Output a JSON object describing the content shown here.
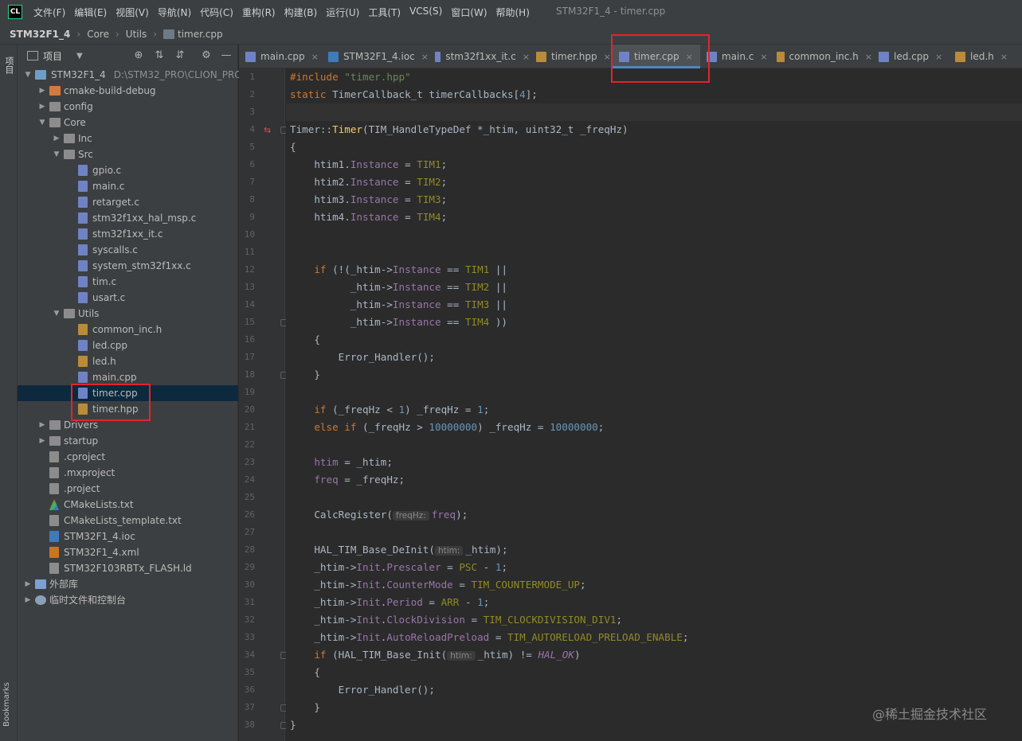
{
  "window": {
    "title": "STM32F1_4 - timer.cpp",
    "logo": "CL"
  },
  "menu": [
    "文件(F)",
    "编辑(E)",
    "视图(V)",
    "导航(N)",
    "代码(C)",
    "重构(R)",
    "构建(B)",
    "运行(U)",
    "工具(T)",
    "VCS(S)",
    "窗口(W)",
    "帮助(H)"
  ],
  "breadcrumb": {
    "project": "STM32F1_4",
    "items": [
      "Core",
      "Utils",
      "timer.cpp"
    ]
  },
  "stripe": {
    "project_label": "项目",
    "bookmarks_label": "Bookmarks"
  },
  "project_panel": {
    "title": "项目",
    "root_label": "STM32F1_4",
    "root_path": "D:\\STM32_PRO\\CLION_PRO",
    "tree": [
      {
        "label": "cmake-build-debug",
        "icon": "folder-orange",
        "arrow": "right",
        "indent": 1
      },
      {
        "label": "config",
        "icon": "folder",
        "arrow": "right",
        "indent": 1
      },
      {
        "label": "Core",
        "icon": "folder",
        "arrow": "down",
        "indent": 1
      },
      {
        "label": "Inc",
        "icon": "folder",
        "arrow": "right",
        "indent": 2
      },
      {
        "label": "Src",
        "icon": "folder",
        "arrow": "down",
        "indent": 2
      },
      {
        "label": "gpio.c",
        "icon": "file-c",
        "indent": 3
      },
      {
        "label": "main.c",
        "icon": "file-c",
        "indent": 3
      },
      {
        "label": "retarget.c",
        "icon": "file-c",
        "indent": 3
      },
      {
        "label": "stm32f1xx_hal_msp.c",
        "icon": "file-c",
        "indent": 3
      },
      {
        "label": "stm32f1xx_it.c",
        "icon": "file-c",
        "indent": 3
      },
      {
        "label": "syscalls.c",
        "icon": "file-c",
        "indent": 3
      },
      {
        "label": "system_stm32f1xx.c",
        "icon": "file-c",
        "indent": 3
      },
      {
        "label": "tim.c",
        "icon": "file-c",
        "indent": 3
      },
      {
        "label": "usart.c",
        "icon": "file-c",
        "indent": 3
      },
      {
        "label": "Utils",
        "icon": "folder",
        "arrow": "down",
        "indent": 2
      },
      {
        "label": "common_inc.h",
        "icon": "file-h",
        "indent": 3
      },
      {
        "label": "led.cpp",
        "icon": "file-cpp",
        "indent": 3
      },
      {
        "label": "led.h",
        "icon": "file-h",
        "indent": 3
      },
      {
        "label": "main.cpp",
        "icon": "file-cpp",
        "indent": 3
      },
      {
        "label": "timer.cpp",
        "icon": "file-cpp",
        "indent": 3,
        "selected": true
      },
      {
        "label": "timer.hpp",
        "icon": "file-h",
        "indent": 3
      },
      {
        "label": "Drivers",
        "icon": "folder",
        "arrow": "right",
        "indent": 1
      },
      {
        "label": "startup",
        "icon": "folder",
        "arrow": "right",
        "indent": 1
      },
      {
        "label": ".cproject",
        "icon": "file-txt",
        "indent": 1
      },
      {
        "label": ".mxproject",
        "icon": "file-txt",
        "indent": 1
      },
      {
        "label": ".project",
        "icon": "file-txt",
        "indent": 1
      },
      {
        "label": "CMakeLists.txt",
        "icon": "cmake",
        "indent": 1
      },
      {
        "label": "CMakeLists_template.txt",
        "icon": "file-txt",
        "indent": 1
      },
      {
        "label": "STM32F1_4.ioc",
        "icon": "file-ioc",
        "indent": 1
      },
      {
        "label": "STM32F1_4.xml",
        "icon": "file-xml",
        "indent": 1
      },
      {
        "label": "STM32F103RBTx_FLASH.ld",
        "icon": "file-txt",
        "indent": 1
      },
      {
        "label": "外部库",
        "icon": "lib",
        "arrow": "right",
        "indent": 0
      },
      {
        "label": "临时文件和控制台",
        "icon": "scratch",
        "arrow": "right",
        "indent": 0
      }
    ]
  },
  "tabs": [
    {
      "label": "main.cpp",
      "icon": "file-cpp"
    },
    {
      "label": "STM32F1_4.ioc",
      "icon": "file-ioc"
    },
    {
      "label": "stm32f1xx_it.c",
      "icon": "file-c"
    },
    {
      "label": "timer.hpp",
      "icon": "file-h"
    },
    {
      "label": "timer.cpp",
      "icon": "file-cpp",
      "active": true
    },
    {
      "label": "main.c",
      "icon": "file-c"
    },
    {
      "label": "common_inc.h",
      "icon": "file-h"
    },
    {
      "label": "led.cpp",
      "icon": "file-cpp"
    },
    {
      "label": "led.h",
      "icon": "file-h"
    }
  ],
  "code": {
    "current_line": 3,
    "lines": [
      [
        [
          "kw",
          "#include "
        ],
        [
          "str",
          "\"timer.hpp\""
        ]
      ],
      [
        [
          "kw",
          "static "
        ],
        [
          "",
          "TimerCallback_t timerCallbacks["
        ],
        [
          "num",
          "4"
        ],
        [
          "",
          "];"
        ]
      ],
      [],
      [
        [
          "",
          "Timer::"
        ],
        [
          "fn",
          "Timer"
        ],
        [
          "",
          "(TIM_HandleTypeDef *_htim, uint32_t _freqHz)"
        ]
      ],
      [
        [
          "",
          "{"
        ]
      ],
      [
        [
          "",
          "    htim1."
        ],
        [
          "fld",
          "Instance"
        ],
        [
          "",
          " = "
        ],
        [
          "mac",
          "TIM1"
        ],
        [
          "",
          ";"
        ]
      ],
      [
        [
          "",
          "    htim2."
        ],
        [
          "fld",
          "Instance"
        ],
        [
          "",
          " = "
        ],
        [
          "mac",
          "TIM2"
        ],
        [
          "",
          ";"
        ]
      ],
      [
        [
          "",
          "    htim3."
        ],
        [
          "fld",
          "Instance"
        ],
        [
          "",
          " = "
        ],
        [
          "mac",
          "TIM3"
        ],
        [
          "",
          ";"
        ]
      ],
      [
        [
          "",
          "    htim4."
        ],
        [
          "fld",
          "Instance"
        ],
        [
          "",
          " = "
        ],
        [
          "mac",
          "TIM4"
        ],
        [
          "",
          ";"
        ]
      ],
      [],
      [],
      [
        [
          "",
          "    "
        ],
        [
          "kw",
          "if "
        ],
        [
          "",
          "(!(_htim->"
        ],
        [
          "fld",
          "Instance"
        ],
        [
          "",
          " == "
        ],
        [
          "mac",
          "TIM1"
        ],
        [
          "",
          " ||"
        ]
      ],
      [
        [
          "",
          "          _htim->"
        ],
        [
          "fld",
          "Instance"
        ],
        [
          "",
          " == "
        ],
        [
          "mac",
          "TIM2"
        ],
        [
          "",
          " ||"
        ]
      ],
      [
        [
          "",
          "          _htim->"
        ],
        [
          "fld",
          "Instance"
        ],
        [
          "",
          " == "
        ],
        [
          "mac",
          "TIM3"
        ],
        [
          "",
          " ||"
        ]
      ],
      [
        [
          "",
          "          _htim->"
        ],
        [
          "fld",
          "Instance"
        ],
        [
          "",
          " == "
        ],
        [
          "mac",
          "TIM4"
        ],
        [
          "",
          " ))"
        ]
      ],
      [
        [
          "",
          "    {"
        ]
      ],
      [
        [
          "",
          "        Error_Handler();"
        ]
      ],
      [
        [
          "",
          "    }"
        ]
      ],
      [],
      [
        [
          "",
          "    "
        ],
        [
          "kw",
          "if "
        ],
        [
          "",
          "(_freqHz < "
        ],
        [
          "num",
          "1"
        ],
        [
          "",
          ") _freqHz = "
        ],
        [
          "num",
          "1"
        ],
        [
          "",
          ";"
        ]
      ],
      [
        [
          "",
          "    "
        ],
        [
          "kw",
          "else if "
        ],
        [
          "",
          "(_freqHz > "
        ],
        [
          "num",
          "10000000"
        ],
        [
          "",
          ") _freqHz = "
        ],
        [
          "num",
          "10000000"
        ],
        [
          "",
          ";"
        ]
      ],
      [],
      [
        [
          "",
          "    "
        ],
        [
          "fld",
          "htim"
        ],
        [
          "",
          " = _htim;"
        ]
      ],
      [
        [
          "",
          "    "
        ],
        [
          "fld",
          "freq"
        ],
        [
          "",
          " = _freqHz;"
        ]
      ],
      [],
      [
        [
          "",
          "    CalcRegister("
        ],
        [
          "hint",
          "freqHz:"
        ],
        [
          "fld",
          "freq"
        ],
        [
          "",
          ");"
        ]
      ],
      [],
      [
        [
          "",
          "    HAL_TIM_Base_DeInit("
        ],
        [
          "hint",
          "htim:"
        ],
        [
          "",
          "_htim);"
        ]
      ],
      [
        [
          "",
          "    _htim->"
        ],
        [
          "fld",
          "Init"
        ],
        [
          "",
          "."
        ],
        [
          "fld",
          "Prescaler"
        ],
        [
          "",
          " = "
        ],
        [
          "mac",
          "PSC"
        ],
        [
          "",
          " - "
        ],
        [
          "num",
          "1"
        ],
        [
          "",
          ";"
        ]
      ],
      [
        [
          "",
          "    _htim->"
        ],
        [
          "fld",
          "Init"
        ],
        [
          "",
          "."
        ],
        [
          "fld",
          "CounterMode"
        ],
        [
          "",
          " = "
        ],
        [
          "mac",
          "TIM_COUNTERMODE_UP"
        ],
        [
          "",
          ";"
        ]
      ],
      [
        [
          "",
          "    _htim->"
        ],
        [
          "fld",
          "Init"
        ],
        [
          "",
          "."
        ],
        [
          "fld",
          "Period"
        ],
        [
          "",
          " = "
        ],
        [
          "mac",
          "ARR"
        ],
        [
          "",
          " - "
        ],
        [
          "num",
          "1"
        ],
        [
          "",
          ";"
        ]
      ],
      [
        [
          "",
          "    _htim->"
        ],
        [
          "fld",
          "Init"
        ],
        [
          "",
          "."
        ],
        [
          "fld",
          "ClockDivision"
        ],
        [
          "",
          " = "
        ],
        [
          "mac",
          "TIM_CLOCKDIVISION_DIV1"
        ],
        [
          "",
          ";"
        ]
      ],
      [
        [
          "",
          "    _htim->"
        ],
        [
          "fld",
          "Init"
        ],
        [
          "",
          "."
        ],
        [
          "fld",
          "AutoReloadPreload"
        ],
        [
          "",
          " = "
        ],
        [
          "mac",
          "TIM_AUTORELOAD_PRELOAD_ENABLE"
        ],
        [
          "",
          ";"
        ]
      ],
      [
        [
          "",
          "    "
        ],
        [
          "kw",
          "if "
        ],
        [
          "",
          "(HAL_TIM_Base_Init("
        ],
        [
          "hint",
          "htim:"
        ],
        [
          "",
          "_htim) != "
        ],
        [
          "it",
          "HAL_OK"
        ],
        [
          "",
          ")"
        ]
      ],
      [
        [
          "",
          "    {"
        ]
      ],
      [
        [
          "",
          "        Error_Handler();"
        ]
      ],
      [
        [
          "",
          "    }"
        ]
      ],
      [
        [
          "",
          "}"
        ]
      ]
    ],
    "fold_lines": [
      4,
      15,
      18,
      34,
      37,
      38
    ]
  },
  "watermark": "@稀土掘金技术社区",
  "colors": {
    "highlight_box": "#e3242b",
    "active_tab_underline": "#4a88c7",
    "selection": "#0d293e"
  }
}
